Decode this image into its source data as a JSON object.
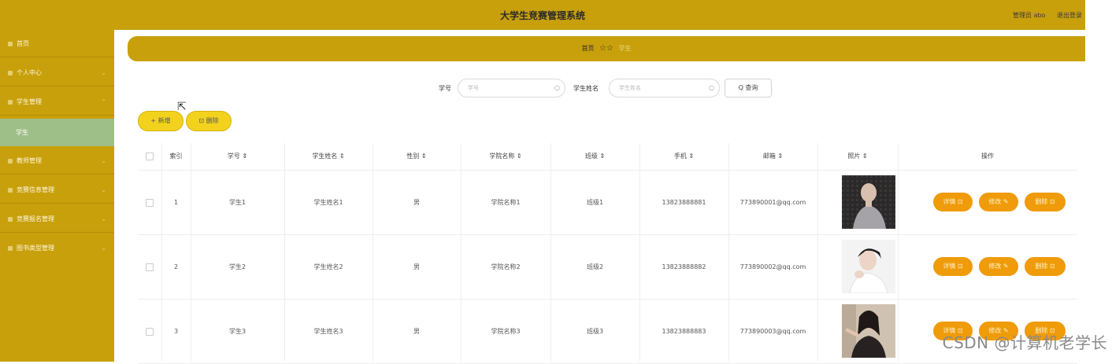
{
  "header": {
    "title": "大学生竞赛管理系统",
    "user": "管理员 abo",
    "logout": "退出登录"
  },
  "sidebar": {
    "items": [
      {
        "label": "首页"
      },
      {
        "label": "个人中心"
      },
      {
        "label": "学生管理"
      },
      {
        "label": "教师管理"
      },
      {
        "label": "竞赛信息管理"
      },
      {
        "label": "竞赛报名管理"
      },
      {
        "label": "图书类型管理"
      }
    ],
    "sub_active": "学生",
    "arrow": "⌄"
  },
  "breadcrumb": {
    "home": "首页",
    "stars": "☆☆",
    "current": "学生"
  },
  "search": {
    "field1_label": "学号",
    "field1_placeholder": "学号",
    "field2_label": "学生姓名",
    "field2_placeholder": "学生姓名",
    "button": "Q 查询"
  },
  "toolbar": {
    "add": "+ 新增",
    "delete": "⊡ 删除"
  },
  "table": {
    "headers": [
      "索引",
      "学号 ⇕",
      "学生姓名 ⇕",
      "性别 ⇕",
      "学院名称 ⇕",
      "班级 ⇕",
      "手机 ⇕",
      "邮箱 ⇕",
      "照片 ⇕",
      "操作"
    ],
    "rows": [
      {
        "index": "1",
        "xuehao": "学生1",
        "name": "学生姓名1",
        "gender": "男",
        "college": "学院名称1",
        "class": "班级1",
        "phone": "13823888881",
        "email": "773890001@qq.com"
      },
      {
        "index": "2",
        "xuehao": "学生2",
        "name": "学生姓名2",
        "gender": "男",
        "college": "学院名称2",
        "class": "班级2",
        "phone": "13823888882",
        "email": "773890002@qq.com"
      },
      {
        "index": "3",
        "xuehao": "学生3",
        "name": "学生姓名3",
        "gender": "男",
        "college": "学院名称3",
        "class": "班级3",
        "phone": "13823888883",
        "email": "773890003@qq.com"
      }
    ],
    "actions": {
      "detail": "详情 ⊡",
      "edit": "修改 ✎",
      "delete": "删除 ⊡"
    }
  },
  "watermark": "CSDN @计算机老学长",
  "colors": {
    "primary": "#c8a00c",
    "active_sub": "#9fbf88",
    "button_yellow": "#f3d21e",
    "op_orange": "#ef9b0a"
  }
}
